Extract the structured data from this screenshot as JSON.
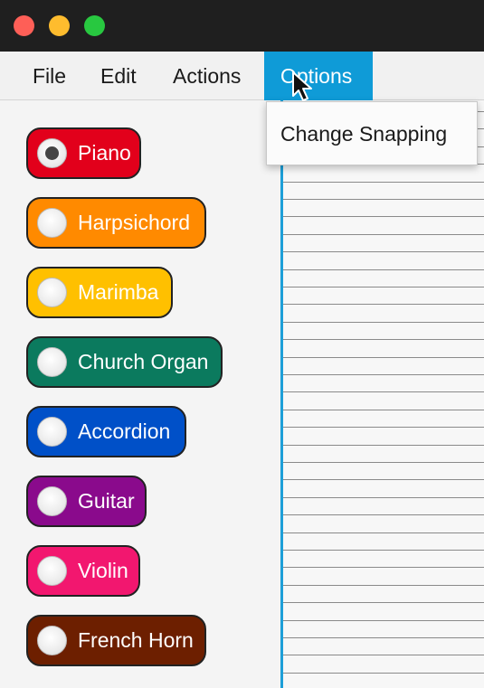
{
  "window": {
    "controls": [
      "close",
      "minimize",
      "maximize"
    ]
  },
  "menu": {
    "file": "File",
    "edit": "Edit",
    "actions": "Actions",
    "options": "Options"
  },
  "dropdown": {
    "items": [
      "Change Snapping"
    ]
  },
  "instruments": [
    {
      "label": "Piano",
      "color": "#e2001b",
      "selected": true
    },
    {
      "label": "Harpsichord",
      "color": "#ff8a00",
      "selected": false
    },
    {
      "label": "Marimba",
      "color": "#ffc000",
      "selected": false
    },
    {
      "label": "Church Organ",
      "color": "#0b7a5e",
      "selected": false
    },
    {
      "label": "Accordion",
      "color": "#0050c8",
      "selected": false
    },
    {
      "label": "Guitar",
      "color": "#8a0a8c",
      "selected": false
    },
    {
      "label": "Violin",
      "color": "#f2176f",
      "selected": false
    },
    {
      "label": "French Horn",
      "color": "#6d1f00",
      "selected": false
    }
  ],
  "colors": {
    "accent": "#0f9bd7",
    "traffic_close": "#fe5f57",
    "traffic_min": "#febc2e",
    "traffic_max": "#28c840"
  }
}
